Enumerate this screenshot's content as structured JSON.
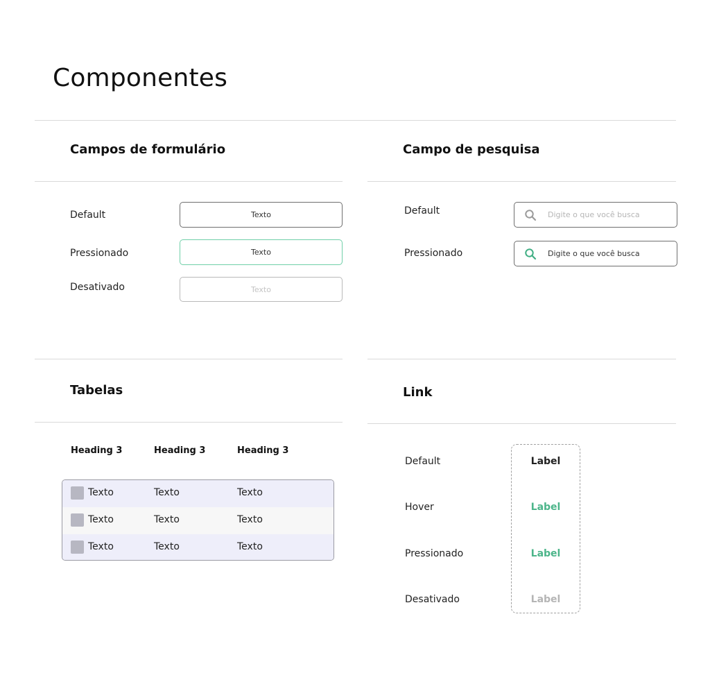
{
  "page": {
    "title": "Componentes"
  },
  "form_fields": {
    "title": "Campos de formulário",
    "rows": [
      {
        "label": "Default",
        "value": "Texto"
      },
      {
        "label": "Pressionado",
        "value": "Texto"
      },
      {
        "label": "Desativado",
        "value": "Texto"
      }
    ]
  },
  "search_field": {
    "title": "Campo de pesquisa",
    "rows": [
      {
        "label": "Default",
        "placeholder": "Digite o que você busca",
        "icon": "search-icon",
        "icon_color": "#9a9a9a"
      },
      {
        "label": "Pressionado",
        "placeholder": "Digite o que você busca",
        "icon": "search-icon",
        "icon_color": "#3fae83"
      }
    ]
  },
  "tables": {
    "title": "Tabelas",
    "headers": [
      "Heading 3",
      "Heading 3",
      "Heading 3"
    ],
    "rows": [
      [
        "Texto",
        "Texto",
        "Texto"
      ],
      [
        "Texto",
        "Texto",
        "Texto"
      ],
      [
        "Texto",
        "Texto",
        "Texto"
      ]
    ]
  },
  "link": {
    "title": "Link",
    "rows": [
      {
        "state": "Default",
        "label": "Label",
        "color": "#222222"
      },
      {
        "state": "Hover",
        "label": "Label",
        "color": "#4cb58a"
      },
      {
        "state": "Pressionado",
        "label": "Label",
        "color": "#4cb58a"
      },
      {
        "state": "Desativado",
        "label": "Label",
        "color": "#b5b5b5"
      }
    ]
  },
  "colors": {
    "accent": "#4cb58a",
    "pressed_border": "#6fcfa8",
    "divider": "#d9d9d9"
  }
}
